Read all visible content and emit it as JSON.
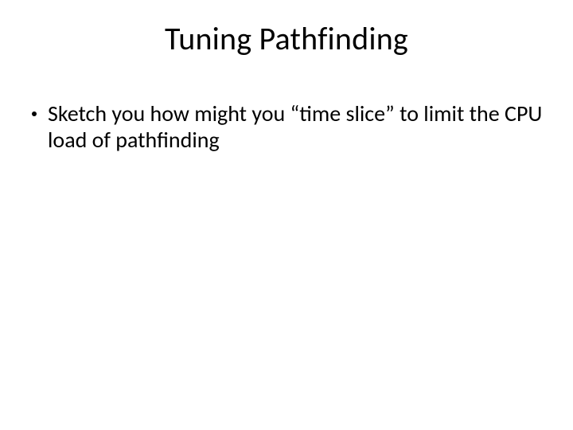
{
  "slide": {
    "title": "Tuning Pathfinding",
    "bullets": [
      {
        "text": "Sketch you how might you “time slice” to limit the CPU load of pathfinding"
      }
    ]
  }
}
